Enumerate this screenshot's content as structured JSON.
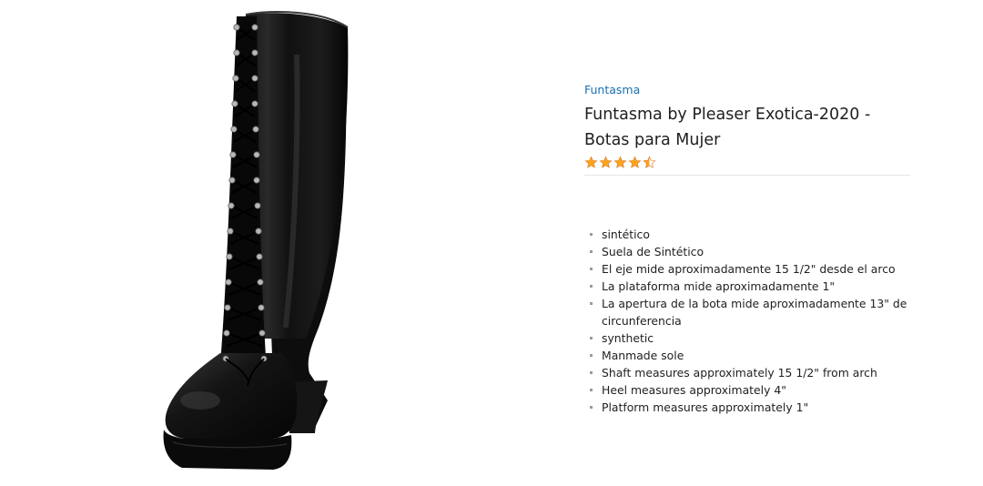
{
  "product": {
    "brand": "Funtasma",
    "title": "Funtasma by Pleaser Exotica-2020 - Botas para Mujer",
    "rating": {
      "value": 4.5,
      "max": 5,
      "icon": "star-icon",
      "color": "#ffa41c"
    },
    "image": {
      "icon": "boot-image",
      "color": "#111111"
    },
    "features": [
      {
        "text": "sintético"
      },
      {
        "text": "Suela de Sintético"
      },
      {
        "text": "El eje mide aproximadamente 15 1/2\" desde el arco"
      },
      {
        "text": "La plataforma mide aproximadamente 1\""
      },
      {
        "text": "La apertura de la bota mide aproximadamente 13\" de circunferencia"
      },
      {
        "text": "synthetic"
      },
      {
        "text": "Manmade sole"
      },
      {
        "text": "Shaft measures approximately 15 1/2\" from arch"
      },
      {
        "text": "Heel measures approximately 4\""
      },
      {
        "text": "Platform measures approximately 1\""
      }
    ]
  },
  "colors": {
    "link": "#1a6fb0",
    "star": "#ffa41c",
    "star_outline": "#de7921"
  }
}
